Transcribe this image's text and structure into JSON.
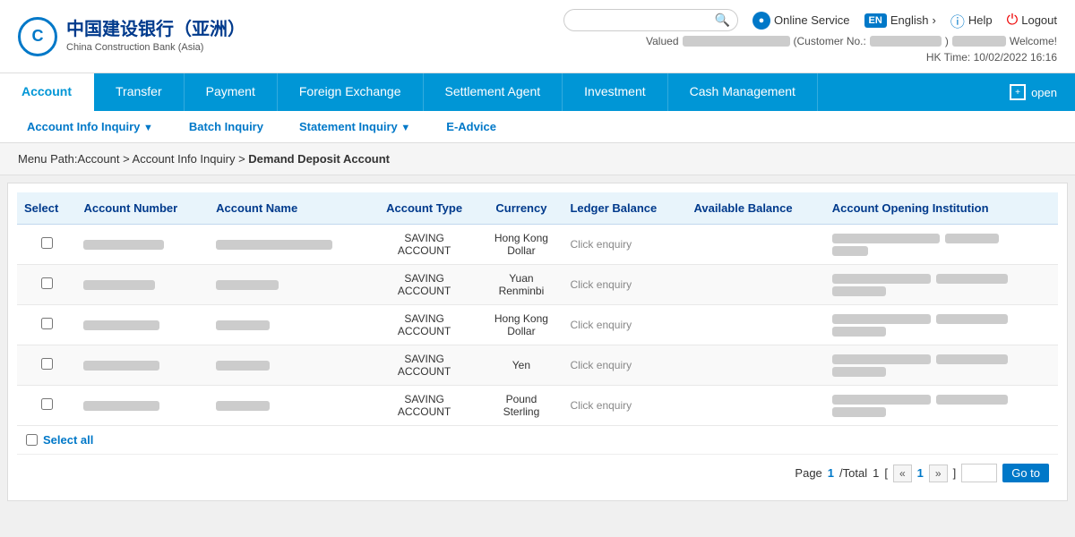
{
  "header": {
    "logo_cn": "中国建设银行（亚洲）",
    "logo_en": "China Construction Bank (Asia)",
    "search_placeholder": "",
    "online_service": "Online Service",
    "language": "English",
    "language_badge": "EN",
    "help": "Help",
    "logout": "Logout",
    "valued_label": "Valued",
    "welcome": "Welcome!",
    "hk_time": "HK Time: 10/02/2022 16:16"
  },
  "navbar": {
    "items": [
      {
        "label": "Account",
        "active": true
      },
      {
        "label": "Transfer",
        "active": false
      },
      {
        "label": "Payment",
        "active": false
      },
      {
        "label": "Foreign Exchange",
        "active": false
      },
      {
        "label": "Settlement Agent",
        "active": false
      },
      {
        "label": "Investment",
        "active": false
      },
      {
        "label": "Cash Management",
        "active": false
      }
    ],
    "open_label": "open"
  },
  "subnav": {
    "items": [
      {
        "label": "Account Info Inquiry",
        "has_arrow": true
      },
      {
        "label": "Batch Inquiry",
        "has_arrow": false
      },
      {
        "label": "Statement Inquiry",
        "has_arrow": true
      },
      {
        "label": "E-Advice",
        "has_arrow": false
      }
    ]
  },
  "breadcrumb": {
    "path": "Menu Path:Account > Account Info Inquiry > ",
    "current": "Demand Deposit Account"
  },
  "table": {
    "headers": [
      "Select",
      "Account Number",
      "Account Name",
      "Account Type",
      "Currency",
      "Ledger Balance",
      "Available Balance",
      "Account Opening Institution"
    ],
    "rows": [
      {
        "account_type": "SAVING\nACCOUNT",
        "currency": "Hong Kong\nDollar",
        "ledger": "Click enquiry"
      },
      {
        "account_type": "SAVING\nACCOUNT",
        "currency": "Yuan\nRenminbi",
        "ledger": "Click enquiry"
      },
      {
        "account_type": "SAVING\nACCOUNT",
        "currency": "Hong Kong\nDollar",
        "ledger": "Click enquiry"
      },
      {
        "account_type": "SAVING\nACCOUNT",
        "currency": "Yen",
        "ledger": "Click enquiry"
      },
      {
        "account_type": "SAVING\nACCOUNT",
        "currency": "Pound\nSterling",
        "ledger": "Click enquiry"
      }
    ],
    "select_all_label": "Select all"
  },
  "pagination": {
    "page_label": "Page",
    "current_page": "1",
    "total_label": "/Total",
    "total_pages": "1",
    "bracket_open": "[",
    "bracket_close": "]",
    "goto_label": "Go to"
  },
  "blurred_widths": {
    "acc_num_1": "90px",
    "acc_num_2": "80px",
    "acc_num_3": "85px",
    "acc_num_4": "85px",
    "acc_num_5": "85px",
    "acc_name_1": "130px",
    "acc_name_2": "70px",
    "acc_name_3": "60px",
    "acc_name_4": "60px",
    "acc_name_5": "60px",
    "inst_1a": "120px",
    "inst_1b": "40px",
    "inst_2a": "110px",
    "inst_2b": "80px",
    "inst_3a": "110px",
    "inst_3b": "80px",
    "inst_4a": "110px",
    "inst_4b": "80px",
    "inst_5a": "110px",
    "inst_5b": "80px"
  }
}
